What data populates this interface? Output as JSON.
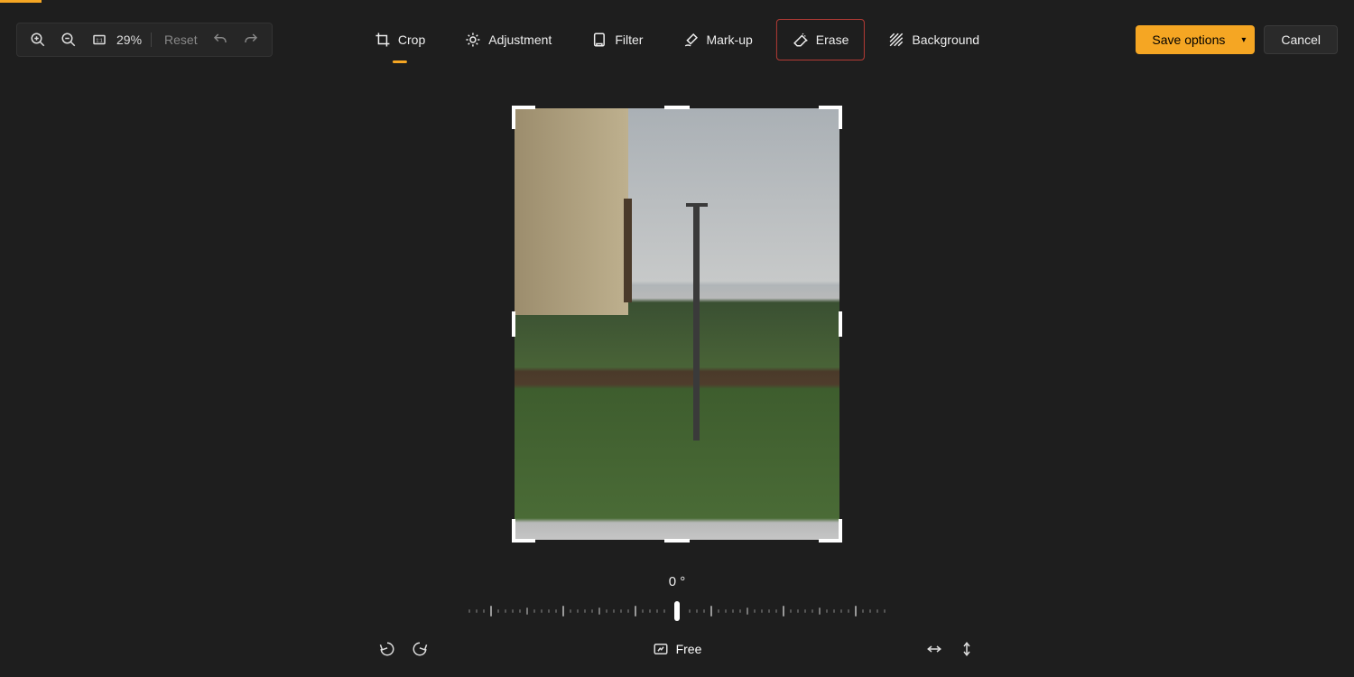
{
  "toolbar": {
    "zoom_value": "29%",
    "reset_label": "Reset"
  },
  "tabs": {
    "crop": "Crop",
    "adjustment": "Adjustment",
    "filter": "Filter",
    "markup": "Mark-up",
    "erase": "Erase",
    "background": "Background"
  },
  "actions": {
    "save_label": "Save options",
    "cancel_label": "Cancel"
  },
  "rotation": {
    "degrees_label": "0 °",
    "aspect_label": "Free"
  }
}
